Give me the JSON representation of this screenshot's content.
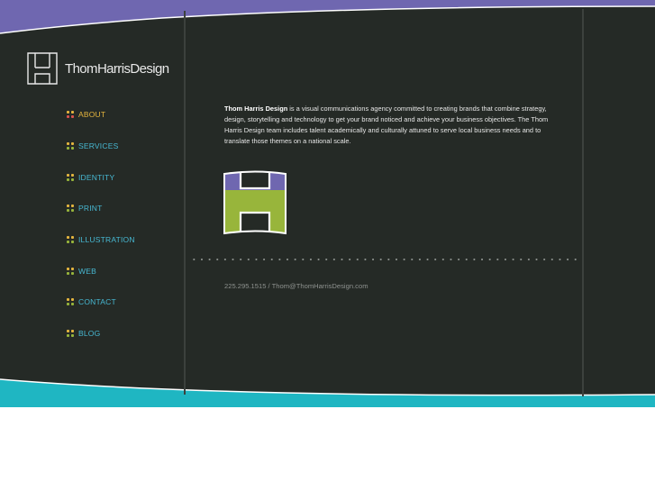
{
  "brand": {
    "name": "ThomHarrisDesign",
    "colors": {
      "background": "#252a26",
      "top_band": "#6f67b0",
      "bottom_band": "#1fb6c2",
      "logo_top": "#6f67b0",
      "logo_bottom": "#98b53b",
      "nav_link": "#47b8d2",
      "nav_active": "#e5b53e"
    }
  },
  "nav": {
    "items": [
      {
        "label": "ABOUT",
        "active": true
      },
      {
        "label": "SERVICES"
      },
      {
        "label": "IDENTITY"
      },
      {
        "label": "PRINT"
      },
      {
        "label": "ILLUSTRATION"
      },
      {
        "label": "WEB"
      },
      {
        "label": "CONTACT"
      },
      {
        "label": "BLOG"
      }
    ]
  },
  "main": {
    "intro_bold": "Thom Harris Design",
    "intro_text": " is a visual communications agency committed to creating brands that combine strategy, design, storytelling and technology to get your brand noticed and achieve your business objectives. The Thom Harris Design team includes talent academically and culturally attuned to serve local business needs and to translate those themes on a national scale.",
    "contact_line": "225.295.1515 / Thom@ThomHarrisDesign.com"
  }
}
